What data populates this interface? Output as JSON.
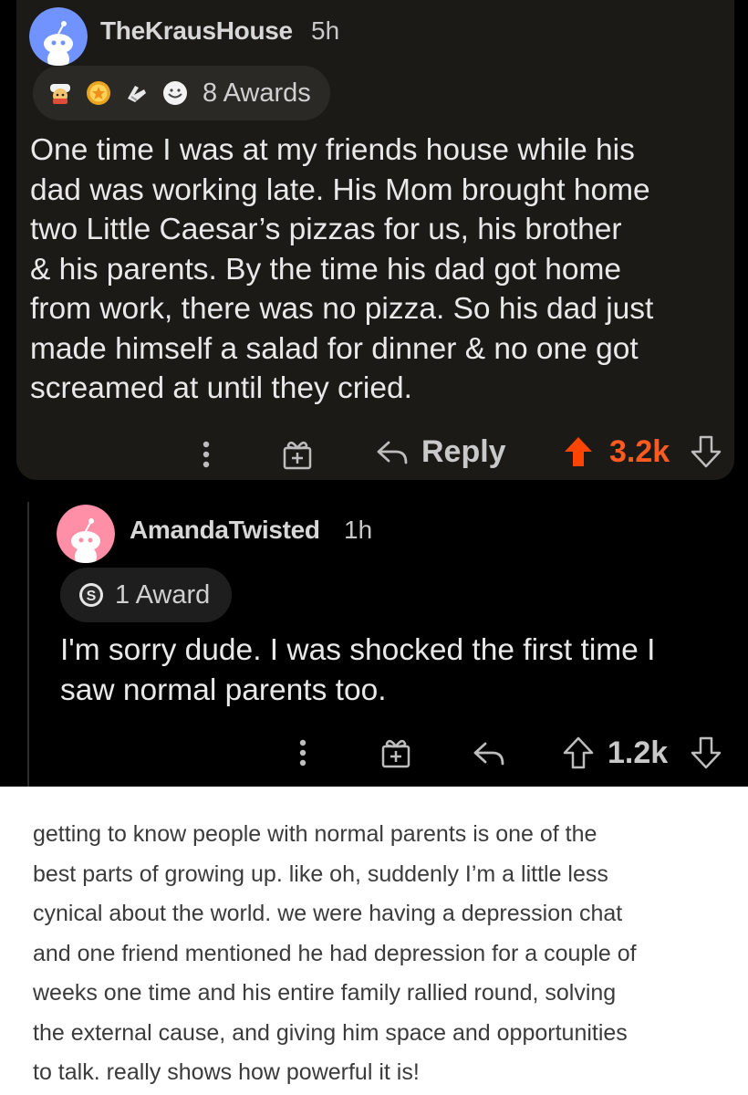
{
  "comment1": {
    "username": "TheKrausHouse",
    "timestamp": "5h",
    "awards": {
      "icons": [
        "chef-award-icon",
        "gold-badge-award-icon",
        "hands-award-icon",
        "wholesome-award-icon"
      ],
      "label": "8 Awards"
    },
    "body_lines": [
      "One time I was at my friends house while his",
      "dad was working late. His Mom brought home",
      "two Little Caesar’s pizzas for us, his brother",
      "& his parents. By the time his dad got home",
      "from work, there was no pizza. So his dad just",
      "made himself a salad for dinner & no one got",
      "screamed at until they cried."
    ],
    "actions": {
      "reply_label": "Reply",
      "score": "3.2k",
      "upvote_color": "#ff4500",
      "score_color": "#ff5a1f"
    }
  },
  "comment2": {
    "username": "AmandaTwisted",
    "timestamp": "1h",
    "awards": {
      "icons": [
        "silver-award-icon"
      ],
      "label": "1 Award"
    },
    "body_lines": [
      "I'm sorry dude. I was shocked the first time I",
      "saw normal parents too."
    ],
    "actions": {
      "score": "1.2k"
    }
  },
  "caption_lines": [
    "getting to know people with normal parents is one of the",
    "best parts of growing up. like oh, suddenly I’m a little less",
    "cynical about the world. we were having a depression chat",
    "and one friend mentioned he had depression for a couple of",
    "weeks one time and his entire family rallied round, solving",
    "the external cause, and giving him space and opportunities",
    "to talk. really shows how powerful it is!"
  ]
}
